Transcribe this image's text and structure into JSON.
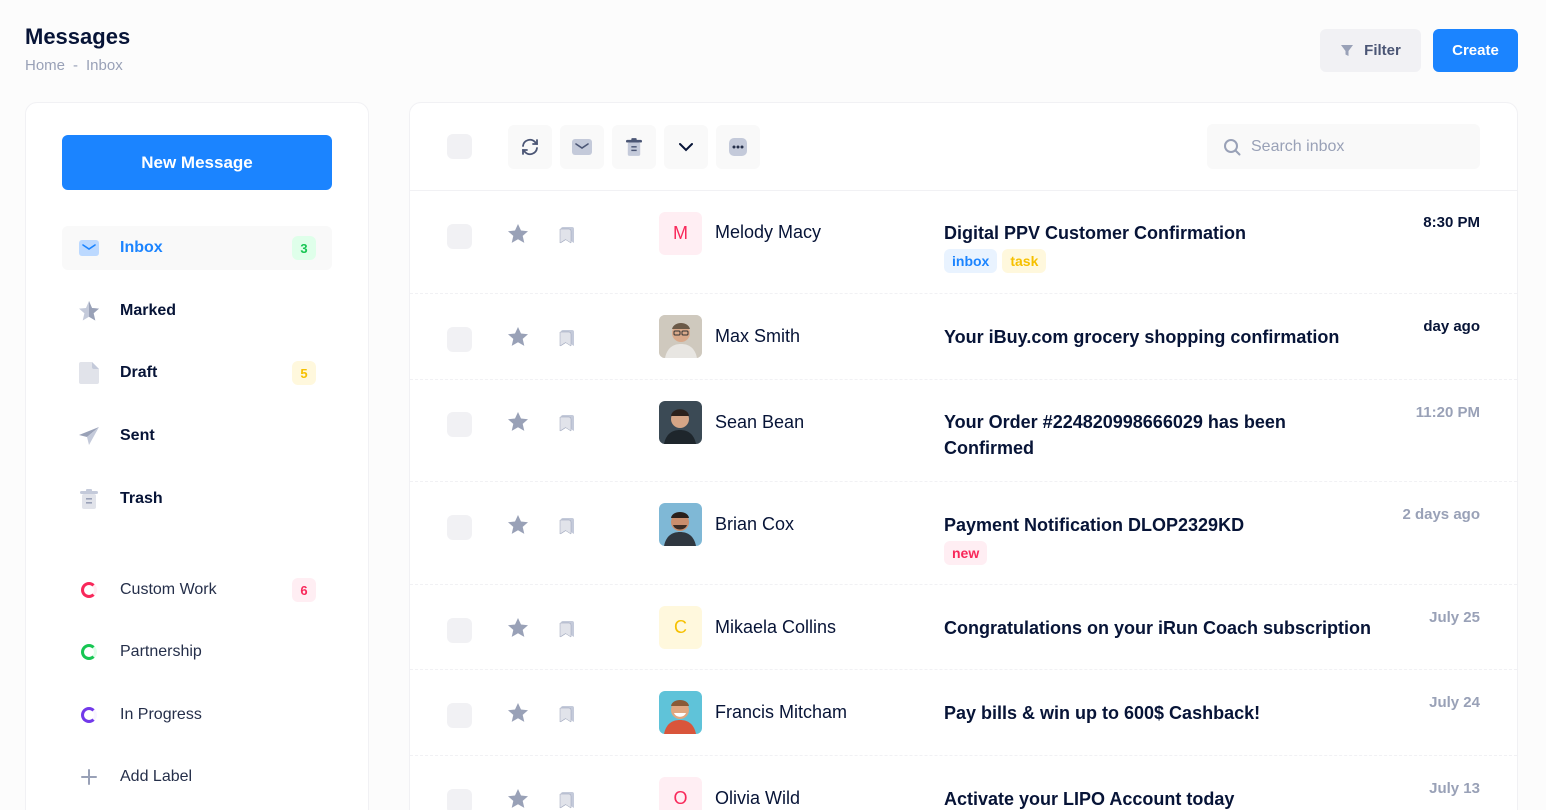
{
  "header": {
    "title": "Messages",
    "breadcrumb": [
      "Home",
      "-",
      "Inbox"
    ],
    "filter_label": "Filter",
    "create_label": "Create"
  },
  "sidebar": {
    "new_message_label": "New Message",
    "folders": [
      {
        "label": "Inbox",
        "icon": "envelope-icon",
        "badge": "3",
        "active": true
      },
      {
        "label": "Marked",
        "icon": "star-icon"
      },
      {
        "label": "Draft",
        "icon": "document-icon",
        "badge": "5"
      },
      {
        "label": "Sent",
        "icon": "paper-plane-icon"
      },
      {
        "label": "Trash",
        "icon": "trash-icon"
      }
    ],
    "labels": [
      {
        "label": "Custom Work",
        "icon": "ring-red-icon",
        "badge": "6"
      },
      {
        "label": "Partnership",
        "icon": "ring-green-icon"
      },
      {
        "label": "In Progress",
        "icon": "ring-purple-icon"
      },
      {
        "label": "Add Label",
        "icon": "plus-icon"
      }
    ]
  },
  "toolbar": {
    "search_placeholder": "Search inbox",
    "buttons": [
      "refresh-icon",
      "envelope-icon",
      "trash-icon",
      "chevron-down-icon",
      "more-dots-icon"
    ]
  },
  "messages": [
    {
      "sender": "Melody Macy",
      "initial": "M",
      "subject": "Digital PPV Customer Confirmation",
      "tags": [
        "inbox",
        "task"
      ],
      "time": "8:30 PM"
    },
    {
      "sender": "Max Smith",
      "subject": "Your iBuy.com grocery shopping confirmation",
      "time": "day ago"
    },
    {
      "sender": "Sean Bean",
      "subject": "Your Order #224820998666029 has been Confirmed",
      "time": "11:20 PM"
    },
    {
      "sender": "Brian Cox",
      "subject": "Payment Notification DLOP2329KD",
      "tags": [
        "new"
      ],
      "time": "2 days ago"
    },
    {
      "sender": "Mikaela Collins",
      "initial": "C",
      "subject": "Congratulations on your iRun Coach subscription",
      "time": "July 25"
    },
    {
      "sender": "Francis Mitcham",
      "subject": "Pay bills & win up to 600$ Cashback!",
      "time": "July 24"
    },
    {
      "sender": "Olivia Wild",
      "initial": "O",
      "subject": "Activate your LIPO Account today",
      "time": "July 13"
    }
  ],
  "colors": {
    "primary": "#1b84ff",
    "success": "#17c653",
    "warning": "#f6c000",
    "danger": "#f8285a",
    "info": "#7239ea"
  }
}
